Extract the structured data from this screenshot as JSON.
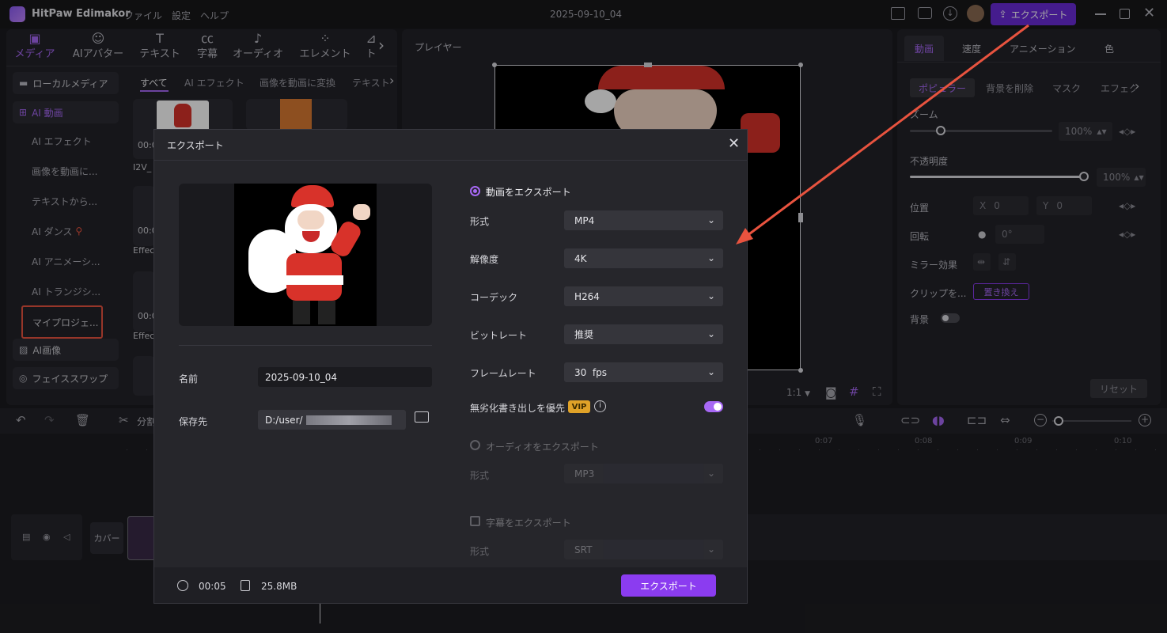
{
  "titlebar": {
    "app_name": "HitPaw Edimakor",
    "menu": [
      "ファイル",
      "設定",
      "ヘルプ"
    ],
    "project_title": "2025-09-10_04",
    "export_button": "エクスポート"
  },
  "media_tabs": [
    {
      "label": "メディア",
      "icon": "media-icon",
      "active": true
    },
    {
      "label": "AIアバター",
      "icon": "avatar-icon"
    },
    {
      "label": "テキスト",
      "icon": "text-icon"
    },
    {
      "label": "字幕",
      "icon": "subtitle-icon"
    },
    {
      "label": "オーディオ",
      "icon": "audio-icon"
    },
    {
      "label": "エレメント",
      "icon": "element-icon"
    },
    {
      "label": "ト",
      "icon": "transition-icon"
    }
  ],
  "sidebar": {
    "local_media": "ローカルメディア",
    "ai_video": "AI 動画",
    "sub_items": [
      "AI エフェクト",
      "画像を動画に...",
      "テキストから...",
      "AI ダンス",
      "AI アニメーシ...",
      "AI トランジシ..."
    ],
    "my_project": "マイプロジェ...",
    "ai_image": "AI画像",
    "face_swap": "フェイススワップ"
  },
  "media_subtabs": [
    "すべて",
    "AI エフェクト",
    "画像を動画に変換",
    "テキスト"
  ],
  "media_thumbs": {
    "duration": "00:0",
    "name1": "I2V_",
    "name2": "Effec",
    "name3": "Effec"
  },
  "player": {
    "title": "プレイヤー",
    "ratio": "1:1"
  },
  "right_panel": {
    "tabs": [
      "動画",
      "速度",
      "アニメーション",
      "色"
    ],
    "subtabs": [
      "ポピュラー",
      "背景を削除",
      "マスク",
      "エフェク"
    ],
    "zoom_label": "ズーム",
    "zoom_value": "100%",
    "zoom_level": 0.1,
    "opacity_label": "不透明度",
    "opacity_value": "100%",
    "opacity_level": 1.0,
    "position_label": "位置",
    "pos_x_label": "X",
    "pos_x": "0",
    "pos_y_label": "Y",
    "pos_y": "0",
    "rotate_label": "回転",
    "rotate_value": "0°",
    "mirror_label": "ミラー効果",
    "clip_label": "クリップを...",
    "replace_button": "置き換え",
    "background_label": "背景",
    "reset_button": "リセット"
  },
  "timeline": {
    "split_label": "分割",
    "ticks": [
      "0:07",
      "0:08",
      "0:09",
      "0:10"
    ],
    "cover_label": "カバー"
  },
  "modal": {
    "title": "エクスポート",
    "name_label": "名前",
    "name_value": "2025-09-10_04",
    "save_label": "保存先",
    "save_path": "D:/user/",
    "export_video_label": "動画をエクスポート",
    "format_label": "形式",
    "format_value": "MP4",
    "resolution_label": "解像度",
    "resolution_value": "4K",
    "codec_label": "コーデック",
    "codec_value": "H264",
    "bitrate_label": "ビットレート",
    "bitrate_value": "推奨",
    "framerate_label": "フレームレート",
    "framerate_value": "30  fps",
    "lossless_label": "無劣化書き出しを優先",
    "vip_badge": "VIP",
    "export_audio_label": "オーディオをエクスポート",
    "audio_format_label": "形式",
    "audio_format_value": "MP3",
    "export_subtitle_label": "字幕をエクスポート",
    "subtitle_format_label": "形式",
    "subtitle_format_value": "SRT",
    "duration": "00:05",
    "filesize": "25.8MB",
    "export_button": "エクスポート"
  },
  "colors": {
    "accent": "#8b3cf0",
    "highlight": "#e8533f",
    "bg": "#1b1b1f"
  }
}
